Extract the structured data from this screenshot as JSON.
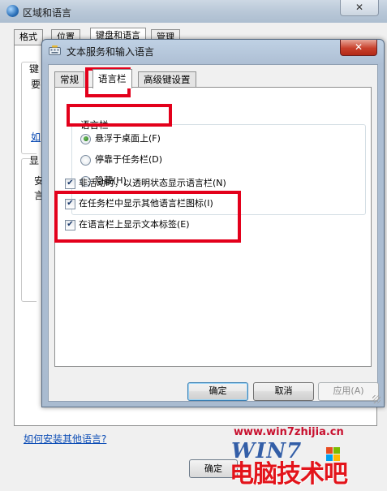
{
  "background_window": {
    "title": "区域和语言",
    "close_label": "✕",
    "tabs": [
      {
        "label": "格式"
      },
      {
        "label": "位置"
      },
      {
        "label": "键盘和语言"
      },
      {
        "label": "管理"
      }
    ],
    "fragments": [
      "键",
      "要",
      "如",
      "显",
      "安",
      "言"
    ],
    "install_link": "如何安装其他语言?",
    "ok_label": "确定"
  },
  "dialog": {
    "title": "文本服务和输入语言",
    "close_label": "✕",
    "tabs": [
      {
        "label": "常规",
        "active": false
      },
      {
        "label": "语言栏",
        "active": true
      },
      {
        "label": "高级键设置",
        "active": false
      }
    ],
    "language_bar_group": {
      "legend": "语言栏",
      "options": [
        {
          "label": "悬浮于桌面上(F)",
          "selected": true
        },
        {
          "label": "停靠于任务栏(D)",
          "selected": false
        },
        {
          "label": "隐藏(H)",
          "selected": false
        }
      ]
    },
    "checkboxes": [
      {
        "label": "非活动时，以透明状态显示语言栏(N)",
        "checked": true
      },
      {
        "label": "在任务栏中显示其他语言栏图标(I)",
        "checked": true
      },
      {
        "label": "在语言栏上显示文本标签(E)",
        "checked": true
      }
    ],
    "buttons": {
      "ok": "确定",
      "cancel": "取消",
      "apply": "应用(A)"
    }
  },
  "watermark": {
    "url": "www.win7zhijia.cn",
    "logo": "WIN7",
    "brand": "电脑技术吧"
  },
  "colors": {
    "highlight": "#e3001b",
    "link": "#0a4bb5"
  }
}
